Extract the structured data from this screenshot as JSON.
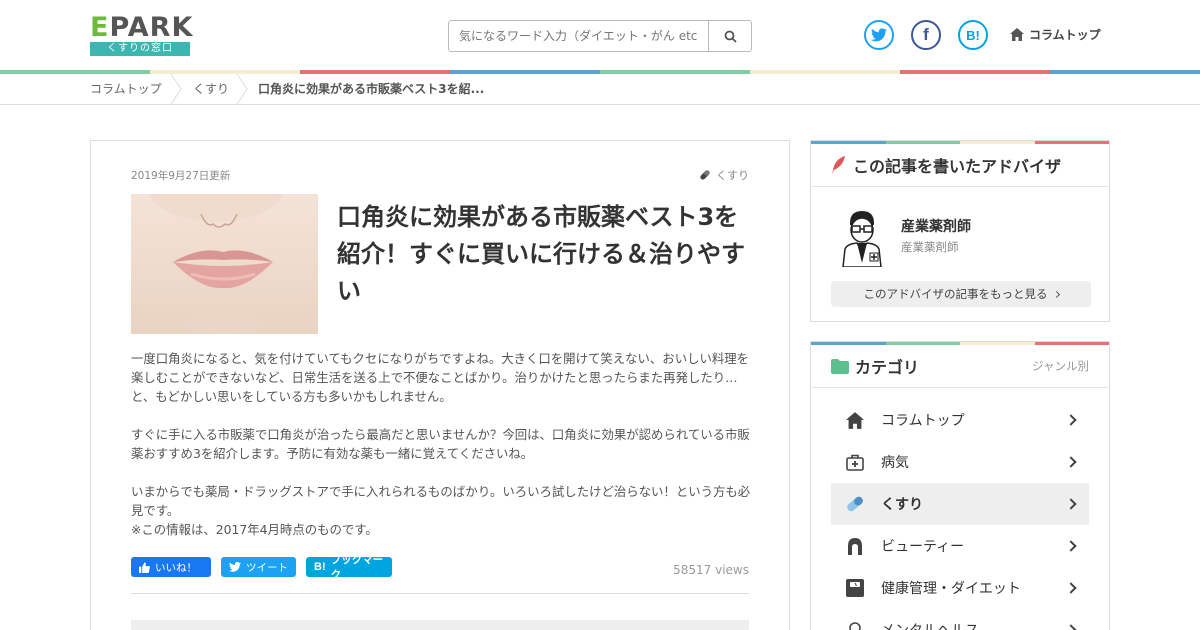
{
  "header": {
    "logo_main": "PARK",
    "logo_letter": "E",
    "logo_sub": "くすりの窓口",
    "search_placeholder": "気になるワード入力（ダイエット・がん etc）",
    "column_top": "コラムトップ"
  },
  "breadcrumb": [
    "コラムトップ",
    "くすり",
    "口角炎に効果がある市販薬ベスト3を紹..."
  ],
  "article": {
    "date": "2019年9月27日更新",
    "tag": "くすり",
    "title": "口角炎に効果がある市販薬ベスト3を紹介！すぐに買いに行ける＆治りやすい",
    "paragraphs": [
      "一度口角炎になると、気を付けていてもクセになりがちですよね。大きく口を開けて笑えない、おいしい料理を楽しむことができないなど、日常生活を送る上で不便なことばかり。治りかけたと思ったらまた再発したり…と、もどかしい思いをしている方も多いかもしれません。",
      "すぐに手に入る市販薬で口角炎が治ったら最高だと思いませんか？今回は、口角炎に効果が認められている市販薬おすすめ3を紹介します。予防に有効な薬も一緒に覚えてくださいね。",
      "いまからでも薬局・ドラッグストアで手に入れられるものばかり。いろいろ試したけど治らない！という方も必見です。",
      "※この情報は、2017年4月時点のものです。"
    ],
    "share": {
      "like": "いいね！",
      "tweet": "ツイート",
      "bookmark": "ブックマーク"
    },
    "views": "58517 views"
  },
  "advisor_panel": {
    "heading": "この記事を書いたアドバイザ",
    "name": "産業薬剤師",
    "role": "産業薬剤師",
    "more": "このアドバイザの記事をもっと見る"
  },
  "category_panel": {
    "heading": "カテゴリ",
    "sub": "ジャンル別",
    "items": [
      {
        "label": "コラムトップ",
        "icon": "home-icon"
      },
      {
        "label": "病気",
        "icon": "medical-bag-icon"
      },
      {
        "label": "くすり",
        "icon": "pill-icon"
      },
      {
        "label": "ビューティー",
        "icon": "hair-icon"
      },
      {
        "label": "健康管理・ダイエット",
        "icon": "scale-icon"
      },
      {
        "label": "メンタルヘルス",
        "icon": "head-icon"
      }
    ]
  },
  "colors": {
    "twitter": "#1da1f2",
    "facebook": "#3b5998",
    "hatena": "#00a4de",
    "like_button": "#1877f2",
    "accent_green": "#6dbb3c",
    "logo_teal": "#3bb6b1",
    "category_folder": "#5bbf8e"
  }
}
